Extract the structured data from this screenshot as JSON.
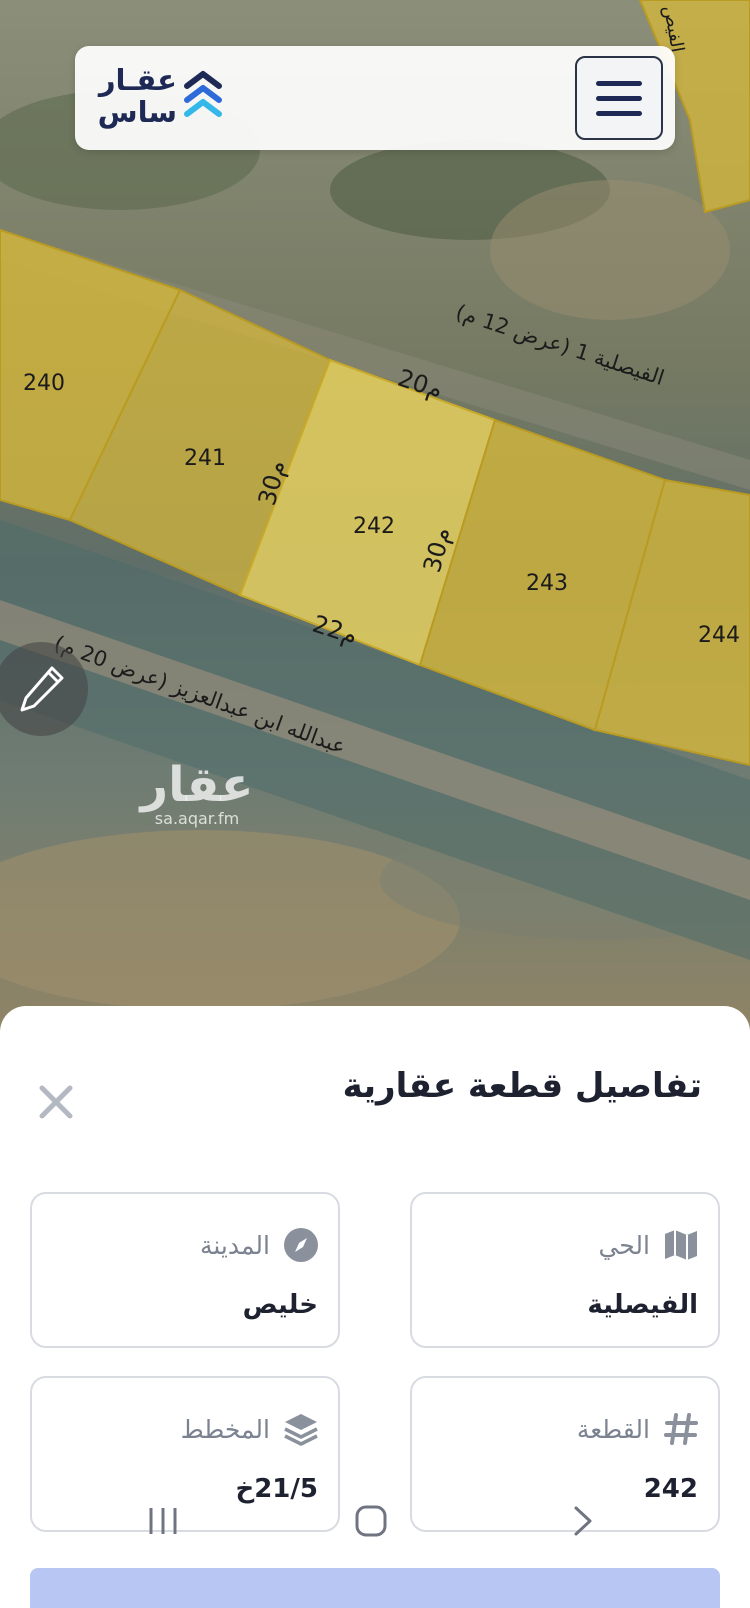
{
  "app": {
    "logo_line1": "عقـار",
    "logo_line2": "ساس",
    "menu_icon": "hamburger-icon"
  },
  "map": {
    "street_top": "الفيصلية 1 (عرض 12 م)",
    "street_bottom": "عبدالله ابن عبدالعزيز (عرض 20 م)",
    "street_top_corner": "الفيص",
    "dim_top": "20م",
    "dim_bottom": "22م",
    "dim_left": "30م",
    "dim_right": "30م",
    "plots": [
      "240",
      "241",
      "242",
      "243",
      "244"
    ],
    "watermark_big": "عقار",
    "watermark_small": "sa.aqar.fm",
    "colors": {
      "plot_fill": "#d7b83a",
      "selected_fill": "#ead35e"
    }
  },
  "sheet": {
    "title": "تفاصيل قطعة عقارية",
    "cards": [
      {
        "label": "الحي",
        "value": "الفيصلية",
        "icon": "map-icon"
      },
      {
        "label": "المدينة",
        "value": "خليص",
        "icon": "compass-icon"
      },
      {
        "label": "القطعة",
        "value": "242",
        "icon": "hash-icon"
      },
      {
        "label": "المخطط",
        "value": "21/5خ",
        "icon": "layers-icon"
      }
    ]
  },
  "nav": {
    "recent": "recent-apps-icon",
    "home": "home-icon",
    "back": "back-icon"
  }
}
